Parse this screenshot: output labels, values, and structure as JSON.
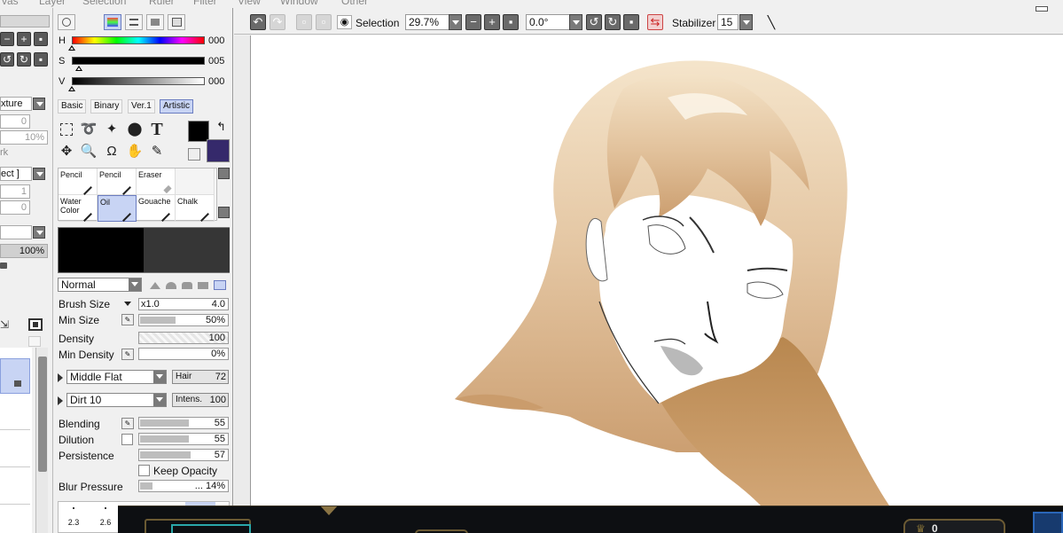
{
  "menu": {
    "items": [
      "vas",
      "Layer",
      "Selection",
      "Ruler",
      "Filter",
      "View",
      "Window",
      "Other"
    ]
  },
  "left_strip": {
    "texture_label": "xture",
    "value_top": "0",
    "percent_top": "10%",
    "mark_label": "rk",
    "select_label": "ect ]",
    "value_mid1": "1",
    "value_mid2": "0",
    "opacity_value": "100%"
  },
  "color": {
    "h_label": "H",
    "h_value": "000",
    "s_label": "S",
    "s_value": "005",
    "v_label": "V",
    "v_value": "000",
    "primary": "#000000",
    "secondary": "#35296b"
  },
  "tabs": [
    "Basic",
    "Binary",
    "Ver.1",
    "Artistic"
  ],
  "tools": {
    "text_tool": "T"
  },
  "brushes": [
    {
      "name": "Pencil",
      "selected": false
    },
    {
      "name": "Pencil",
      "selected": false
    },
    {
      "name": "Eraser",
      "selected": false
    },
    {
      "name": "Water Color",
      "selected": false
    },
    {
      "name": "Oil",
      "selected": true
    },
    {
      "name": "Gouache",
      "selected": false
    },
    {
      "name": "Chalk",
      "selected": false
    }
  ],
  "brush_settings": {
    "blend_mode": "Normal",
    "brush_size_label": "Brush Size",
    "brush_size_mult": "x1.0",
    "brush_size_value": "4.0",
    "min_size_label": "Min Size",
    "min_size_value": "50%",
    "density_label": "Density",
    "density_value": "100",
    "min_density_label": "Min Density",
    "min_density_value": "0%",
    "shape": "Middle Flat",
    "shape_chip_label": "Hair",
    "shape_chip_value": "72",
    "texture": "Dirt 10",
    "texture_chip_label": "Intens.",
    "texture_chip_value": "100",
    "blending_label": "Blending",
    "blending_value": "55",
    "dilution_label": "Dilution",
    "dilution_value": "55",
    "persistence_label": "Persistence",
    "persistence_value": "57",
    "keep_opacity_label": "Keep Opacity",
    "blur_pressure_label": "Blur Pressure",
    "blur_pressure_value": "... 14%",
    "size_presets": [
      "2.3",
      "2.6"
    ]
  },
  "toolbar": {
    "selection_label": "Selection",
    "zoom_value": "29.7%",
    "rotation_value": "0.0°",
    "stabilizer_label": "Stabilizer",
    "stabilizer_value": "15"
  },
  "game_overlay": {
    "counter": "0"
  }
}
